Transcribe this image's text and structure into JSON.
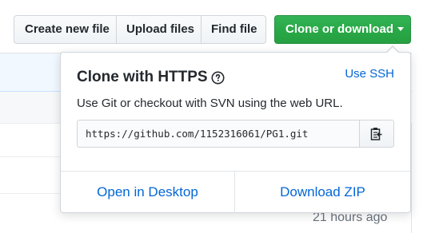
{
  "toolbar": {
    "create_new_file": "Create new file",
    "upload_files": "Upload files",
    "find_file": "Find file",
    "clone_or_download": "Clone or download"
  },
  "clone_panel": {
    "title": "Clone with HTTPS",
    "use_ssh": "Use SSH",
    "description": "Use Git or checkout with SVN using the web URL.",
    "url": "https://github.com/1152316061/PG1.git",
    "open_in_desktop": "Open in Desktop",
    "download_zip": "Download ZIP"
  },
  "file_list": {
    "last_commit_time": "21 hours ago"
  },
  "icons": {
    "help": "question-circle-icon",
    "copy": "clipboard-icon",
    "caret": "caret-down-icon"
  },
  "colors": {
    "primary_green": "#28a745",
    "link_blue": "#0366d6",
    "border": "#d1d5da"
  }
}
